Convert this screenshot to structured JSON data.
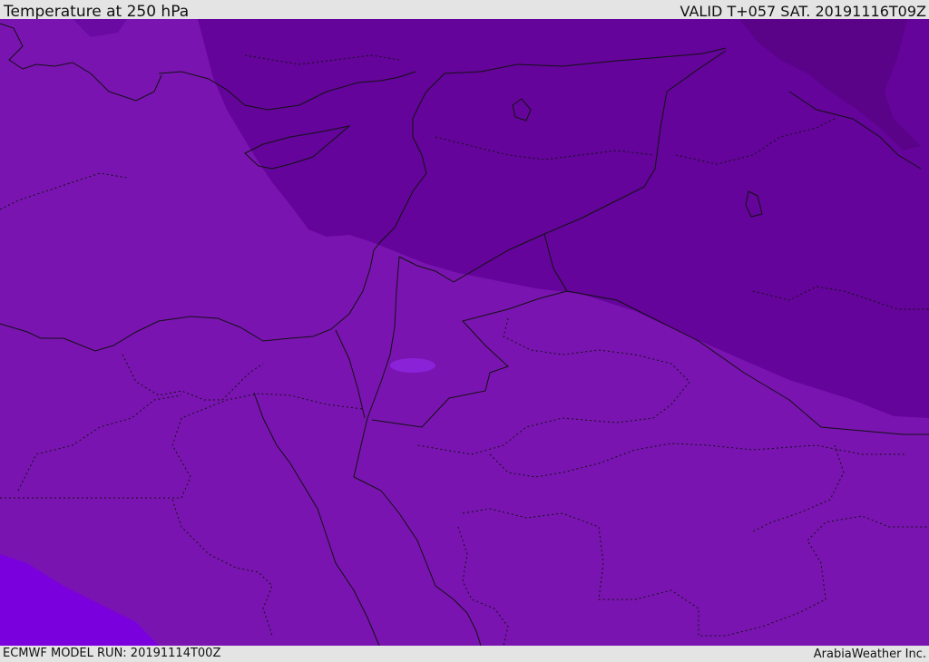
{
  "header": {
    "title": "Temperature at 250 hPa",
    "valid_time": "VALID T+057 SAT. 20191116T09Z"
  },
  "footer": {
    "model_run": "ECMWF MODEL RUN: 20191114T00Z",
    "credit": "ArabiaWeather Inc."
  },
  "map": {
    "field": "temperature-250hPa",
    "colors": {
      "background_band": "#7a14b1",
      "cold_band": "#64049a",
      "coldest_band": "#5a0389",
      "warm_band": "#7a00de",
      "small_warm_patch": "#8a22d8",
      "coastline": "#111111",
      "border": "#111111"
    }
  }
}
